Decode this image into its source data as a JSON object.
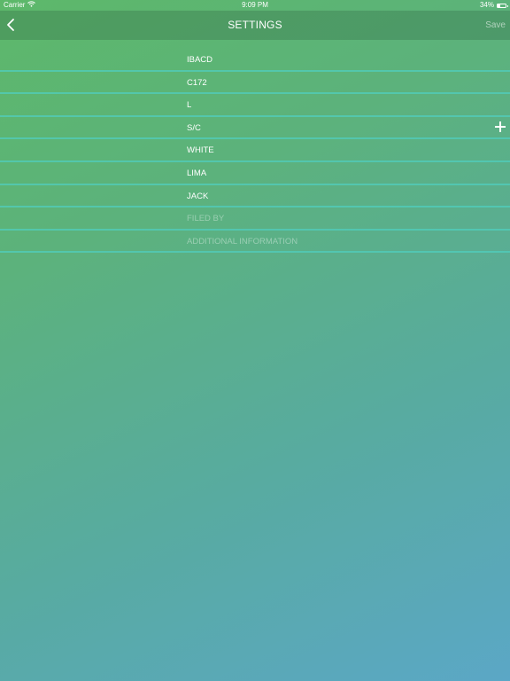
{
  "status_bar": {
    "carrier": "Carrier",
    "time": "9:09 PM",
    "battery_percent": "34%",
    "battery_level": 0.34,
    "icons": [
      "wifi-icon",
      "battery-icon"
    ]
  },
  "nav": {
    "back_icon": "chevron-left-icon",
    "title": "SETTINGS",
    "save_label": "Save"
  },
  "fields": [
    {
      "label": "IBACD"
    },
    {
      "label": "C172"
    },
    {
      "label": "L"
    },
    {
      "label": "S/C",
      "action_icon": "plus-icon"
    },
    {
      "label": "WHITE"
    },
    {
      "label": "LIMA"
    },
    {
      "label": "JACK"
    },
    {
      "placeholder": "FILED BY"
    },
    {
      "placeholder": "ADDITIONAL INFORMATION"
    }
  ],
  "colors": {
    "gradient_start": "#5db86a",
    "gradient_end": "#5ba7c6",
    "separator": "#50cdbe",
    "text": "#ffffff"
  }
}
